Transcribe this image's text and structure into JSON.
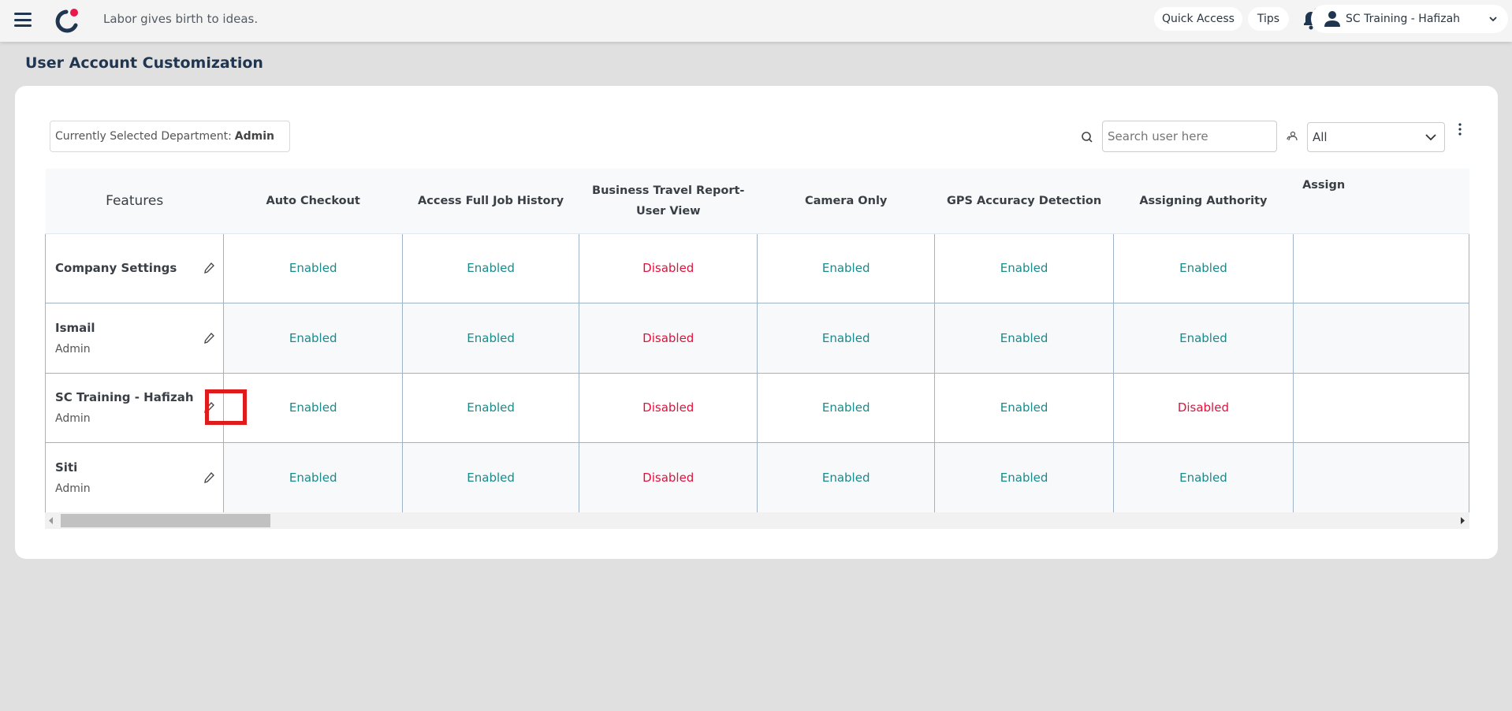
{
  "header": {
    "tagline": "Labor gives birth to ideas.",
    "quick_access": "Quick Access",
    "tips": "Tips",
    "user_name": "SC Training - Hafizah"
  },
  "page": {
    "title": "User Account Customization"
  },
  "toolbar": {
    "dept_label": "Currently Selected Department:",
    "dept_value": "Admin",
    "search_placeholder": "Search user here",
    "filter_value": "All"
  },
  "colors": {
    "enabled": "#1a8a8a",
    "disabled": "#e0123b",
    "brand": "#1f3550",
    "accent": "#e8184c"
  },
  "table": {
    "columns": [
      "Features",
      "Auto Checkout",
      "Access Full Job History",
      "Business Travel Report-User View",
      "Camera Only",
      "GPS Accuracy Detection",
      "Assigning Authority",
      "Assign"
    ],
    "rows": [
      {
        "name": "Company Settings",
        "role": "",
        "values": [
          "Enabled",
          "Enabled",
          "Disabled",
          "Enabled",
          "Enabled",
          "Enabled"
        ]
      },
      {
        "name": "Ismail",
        "role": "Admin",
        "values": [
          "Enabled",
          "Enabled",
          "Disabled",
          "Enabled",
          "Enabled",
          "Enabled"
        ]
      },
      {
        "name": "SC Training - Hafizah",
        "role": "Admin",
        "values": [
          "Enabled",
          "Enabled",
          "Disabled",
          "Enabled",
          "Enabled",
          "Disabled"
        ]
      },
      {
        "name": "Siti",
        "role": "Admin",
        "values": [
          "Enabled",
          "Enabled",
          "Disabled",
          "Enabled",
          "Enabled",
          "Enabled"
        ]
      }
    ]
  }
}
